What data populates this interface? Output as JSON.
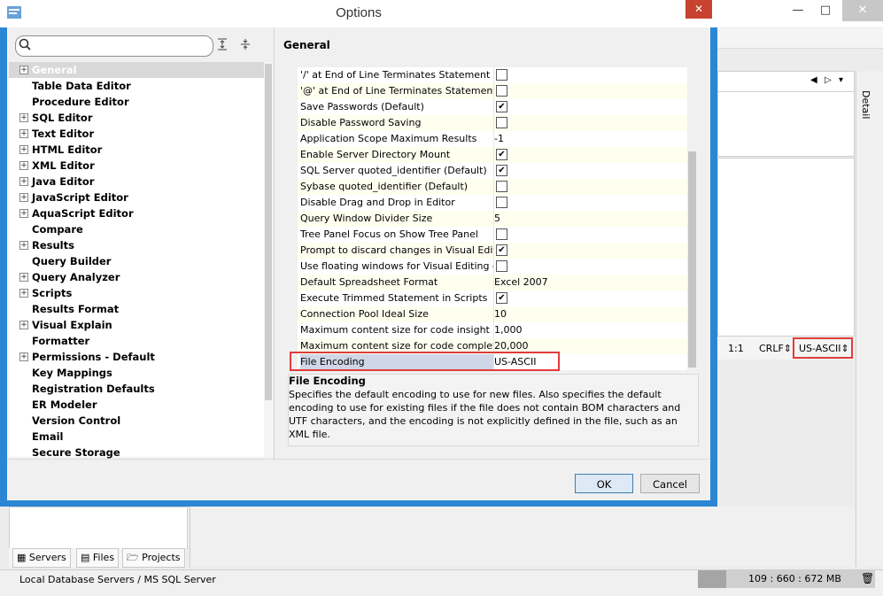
{
  "dialog": {
    "title": "Options",
    "search": {
      "placeholder": "",
      "value": ""
    },
    "close_glyph": "✕",
    "section_title": "General",
    "tree": [
      {
        "label": "General",
        "expandable": true,
        "selected": true
      },
      {
        "label": "Table Data Editor",
        "expandable": false
      },
      {
        "label": "Procedure Editor",
        "expandable": false
      },
      {
        "label": "SQL Editor",
        "expandable": true
      },
      {
        "label": "Text Editor",
        "expandable": true
      },
      {
        "label": "HTML Editor",
        "expandable": true
      },
      {
        "label": "XML Editor",
        "expandable": true
      },
      {
        "label": "Java Editor",
        "expandable": true
      },
      {
        "label": "JavaScript Editor",
        "expandable": true
      },
      {
        "label": "AquaScript Editor",
        "expandable": true
      },
      {
        "label": "Compare",
        "expandable": false
      },
      {
        "label": "Results",
        "expandable": true
      },
      {
        "label": "Query Builder",
        "expandable": false
      },
      {
        "label": "Query Analyzer",
        "expandable": true
      },
      {
        "label": "Scripts",
        "expandable": true
      },
      {
        "label": "Results Format",
        "expandable": false
      },
      {
        "label": "Visual Explain",
        "expandable": true
      },
      {
        "label": "Formatter",
        "expandable": false
      },
      {
        "label": "Permissions - Default",
        "expandable": true
      },
      {
        "label": "Key Mappings",
        "expandable": false
      },
      {
        "label": "Registration Defaults",
        "expandable": false
      },
      {
        "label": "ER Modeler",
        "expandable": false
      },
      {
        "label": "Version Control",
        "expandable": false
      },
      {
        "label": "Email",
        "expandable": false
      },
      {
        "label": "Secure Storage",
        "expandable": false
      }
    ],
    "settings": [
      {
        "name": "'/' at End of Line Terminates Statement",
        "type": "check",
        "checked": false
      },
      {
        "name": "'@' at End of Line Terminates Statement",
        "type": "check",
        "checked": false
      },
      {
        "name": "Save Passwords (Default)",
        "type": "check",
        "checked": true
      },
      {
        "name": "Disable Password Saving",
        "type": "check",
        "checked": false
      },
      {
        "name": "Application Scope Maximum Results",
        "type": "text",
        "value": "-1"
      },
      {
        "name": "Enable Server Directory Mount",
        "type": "check",
        "checked": true
      },
      {
        "name": "SQL Server quoted_identifier (Default)",
        "type": "check",
        "checked": true
      },
      {
        "name": "Sybase quoted_identifier (Default)",
        "type": "check",
        "checked": false
      },
      {
        "name": "Disable Drag and Drop in Editor",
        "type": "check",
        "checked": false
      },
      {
        "name": "Query Window Divider Size",
        "type": "text",
        "value": "5"
      },
      {
        "name": "Tree Panel Focus on Show Tree Panel",
        "type": "check",
        "checked": false
      },
      {
        "name": "Prompt to discard changes in Visual Editing ...",
        "type": "check",
        "checked": true
      },
      {
        "name": "Use floating windows for Visual Editing dialogs",
        "type": "check",
        "checked": false
      },
      {
        "name": "Default Spreadsheet Format",
        "type": "text",
        "value": "Excel 2007"
      },
      {
        "name": "Execute Trimmed Statement in Scripts",
        "type": "check",
        "checked": true
      },
      {
        "name": "Connection Pool Ideal Size",
        "type": "text",
        "value": "10"
      },
      {
        "name": "Maximum content size for code insight (K)",
        "type": "text",
        "value": "1,000"
      },
      {
        "name": "Maximum content size for code completion (K)",
        "type": "text",
        "value": "20,000"
      },
      {
        "name": "File Encoding",
        "type": "text",
        "value": "US-ASCII",
        "selected": true
      }
    ],
    "description": {
      "title": "File Encoding",
      "text": "Specifies the default encoding to use for new files. Also specifies the default encoding to use for existing files if the file does not contain BOM characters and UTF characters, and the encoding is not explicitly defined in the file, such as an XML file."
    },
    "ok_label": "OK",
    "cancel_label": "Cancel"
  },
  "background": {
    "detail_label": "Detail",
    "cursor_pos": "1:1",
    "line_ending": "CRLF",
    "encoding": "US-ASCII",
    "bottom_tabs": [
      "Servers",
      "Files",
      "Projects"
    ],
    "status_text": "Local Database Servers / MS SQL Server",
    "memory": "109 : 660 : 672 MB",
    "memory_used_fraction": 0.16
  }
}
